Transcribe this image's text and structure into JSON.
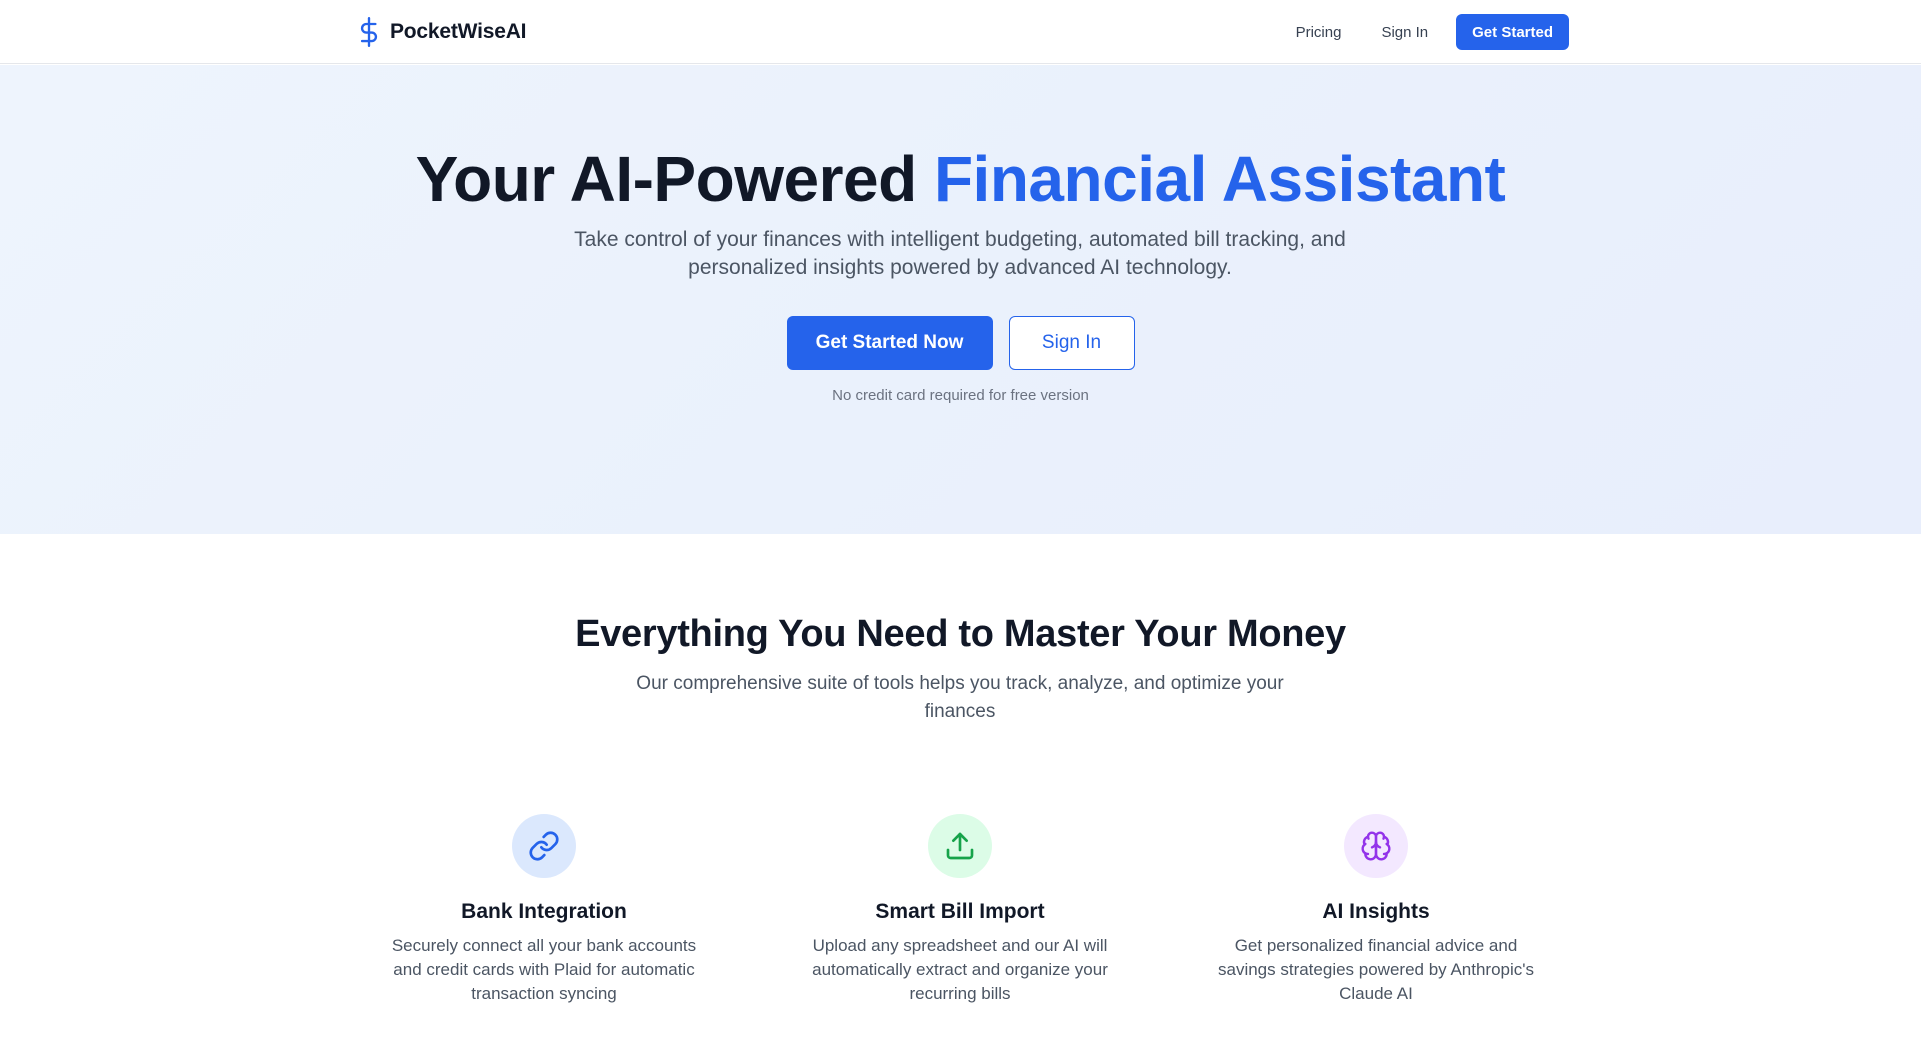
{
  "header": {
    "brand_name": "PocketWiseAI",
    "nav": {
      "pricing": "Pricing",
      "sign_in": "Sign In",
      "get_started": "Get Started"
    }
  },
  "hero": {
    "title_main": "Your AI-Powered ",
    "title_accent": "Financial Assistant",
    "subtitle": "Take control of your finances with intelligent budgeting, automated bill tracking, and personalized insights powered by advanced AI technology.",
    "primary_cta": "Get Started Now",
    "secondary_cta": "Sign In",
    "note": "No credit card required for free version"
  },
  "features": {
    "title": "Everything You Need to Master Your Money",
    "subtitle": "Our comprehensive suite of tools helps you track, analyze, and optimize your finances",
    "items": [
      {
        "icon": "link-icon",
        "title": "Bank Integration",
        "description": "Securely connect all your bank accounts and credit cards with Plaid for automatic transaction syncing"
      },
      {
        "icon": "upload-icon",
        "title": "Smart Bill Import",
        "description": "Upload any spreadsheet and our AI will automatically extract and organize your recurring bills"
      },
      {
        "icon": "brain-icon",
        "title": "AI Insights",
        "description": "Get personalized financial advice and savings strategies powered by Anthropic's Claude AI"
      }
    ]
  },
  "colors": {
    "brand_blue": "#2563eb",
    "text_dark": "#111827",
    "text_muted": "#4b5563",
    "hero_bg": "#eaf1fc",
    "icon_bg_blue": "#dbe8fd",
    "icon_bg_green": "#dcfce7",
    "icon_bg_purple": "#f3e8ff",
    "icon_green": "#16a34a",
    "icon_purple": "#9333ea"
  }
}
